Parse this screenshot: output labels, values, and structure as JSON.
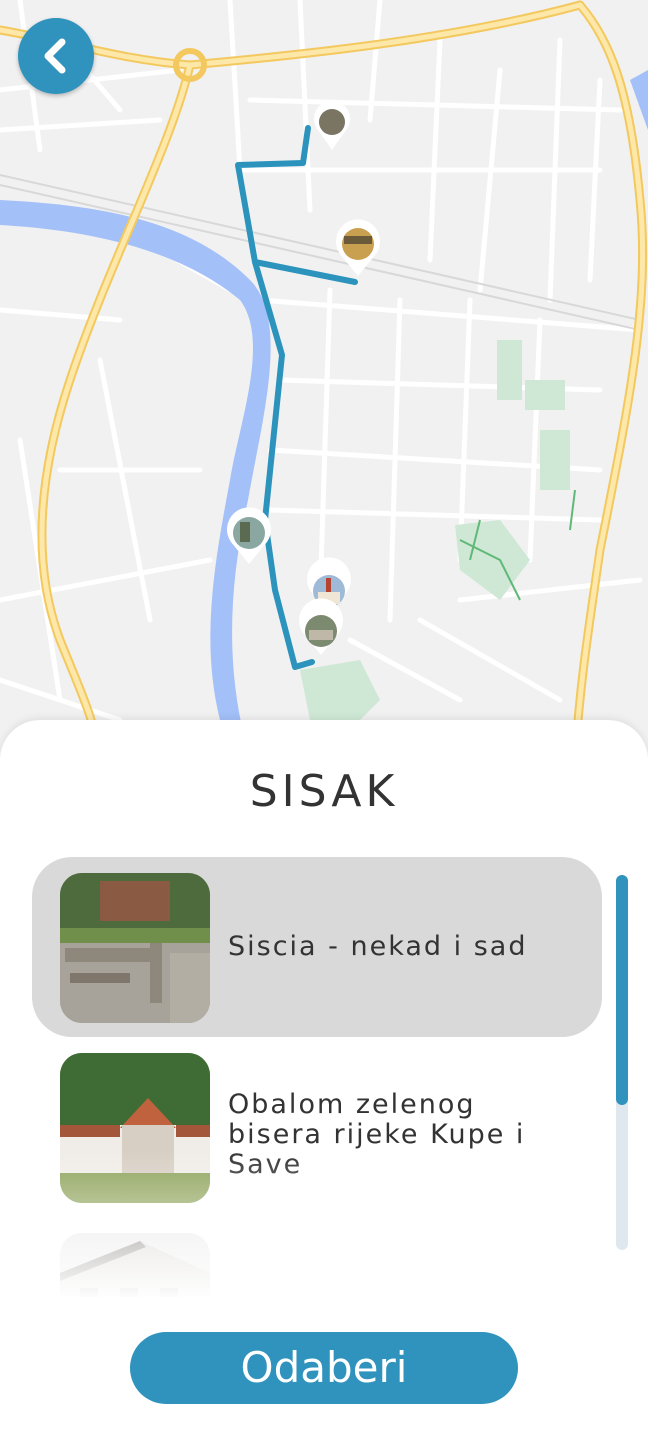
{
  "header": {
    "back_icon": "chevron-left-icon"
  },
  "map": {
    "colors": {
      "route": "#2c93bd",
      "river": "#a3c0f8",
      "road_major": "#f7d57a",
      "park": "#cfe8d6",
      "background": "#f1f1f1"
    },
    "markers": [
      "place-photo-1",
      "place-photo-2",
      "place-photo-3",
      "place-photo-4",
      "place-photo-5"
    ]
  },
  "sheet": {
    "title": "SISAK",
    "routes": [
      {
        "label": "Siscia - nekad i sad",
        "selected": true
      },
      {
        "label_lines": [
          "Obalom zelenog",
          "bisera rijeke Kupe i",
          "Save"
        ],
        "selected": false
      },
      {
        "label": "",
        "selected": false
      }
    ],
    "button_label": "Odaberi"
  },
  "accent_color": "#2f93bd"
}
